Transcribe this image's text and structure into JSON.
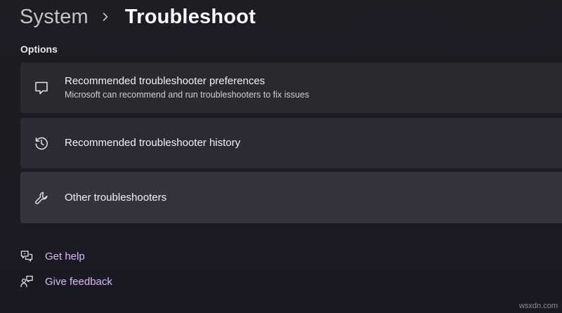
{
  "breadcrumb": {
    "parent": "System",
    "current": "Troubleshoot",
    "separator_icon": "chevron-right-icon"
  },
  "options": {
    "label": "Options",
    "items": [
      {
        "icon": "chat-bubble-icon",
        "title": "Recommended troubleshooter preferences",
        "subtitle": "Microsoft can recommend and run troubleshooters to fix issues"
      },
      {
        "icon": "history-icon",
        "title": "Recommended troubleshooter history"
      },
      {
        "icon": "wrench-icon",
        "title": "Other troubleshooters"
      }
    ]
  },
  "links": {
    "help": {
      "icon": "help-chat-icon",
      "label": "Get help"
    },
    "feedback": {
      "icon": "feedback-icon",
      "label": "Give feedback"
    }
  },
  "watermark": "wsxdn.com",
  "colors": {
    "background": "#1c1b22",
    "card": "#2b2a31",
    "card_hover": "#35343c",
    "link_accent": "#d9b9f7"
  }
}
